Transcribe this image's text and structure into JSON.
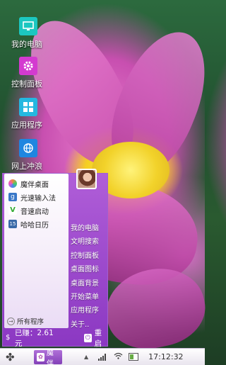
{
  "desktop": {
    "icons": [
      {
        "label": "我的电脑",
        "icon": "monitor-icon",
        "color": "#1cc7c0"
      },
      {
        "label": "控制面板",
        "icon": "gear-icon",
        "color": "#d43ad0"
      },
      {
        "label": "应用程序",
        "icon": "apps-grid-icon",
        "color": "#24b8e0"
      },
      {
        "label": "网上冲浪",
        "icon": "globe-icon",
        "color": "#1f86e0"
      }
    ]
  },
  "start_menu": {
    "pinned": [
      {
        "label": "魔伴桌面",
        "icon": "pinwheel-icon"
      },
      {
        "label": "光速输入法",
        "icon": "g-keyboard-icon"
      },
      {
        "label": "音速启动",
        "icon": "v-launch-icon"
      },
      {
        "label": "哈哈日历",
        "icon": "calendar-icon"
      }
    ],
    "all_programs": "所有程序",
    "right_items": [
      "我的电脑",
      "文明搜索",
      "控制面板",
      "桌面图标",
      "桌面背景",
      "开始菜单",
      "应用程序",
      "关于.."
    ],
    "earned": "已赚：2.61元",
    "restart": "重启"
  },
  "taskbar": {
    "task_label": "魔伴",
    "clock": "17:12:32",
    "accent": "#8b38c2"
  }
}
